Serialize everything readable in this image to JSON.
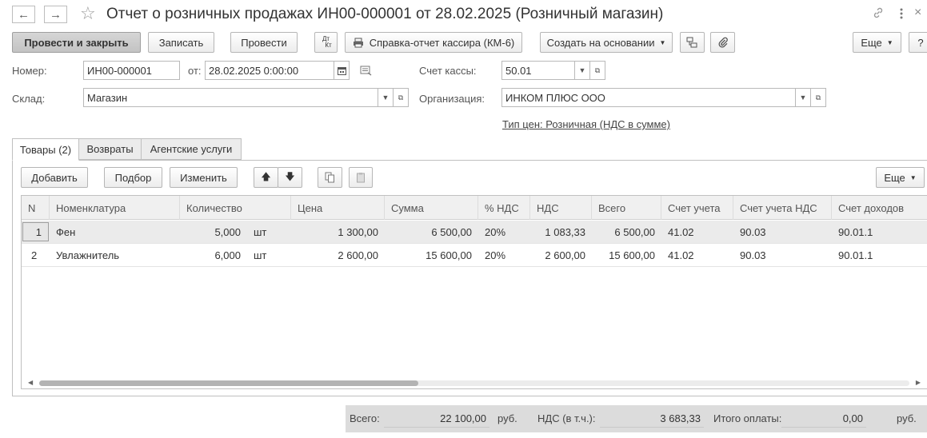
{
  "title": "Отчет о розничных продажах ИН00-000001 от 28.02.2025 (Розничный магазин)",
  "nav": {
    "back_icon": "←",
    "forward_icon": "→"
  },
  "toolbar": {
    "post_close": "Провести и закрыть",
    "save": "Записать",
    "post": "Провести",
    "dt_kt_top": "Дт",
    "dt_kt_bottom": "Кт",
    "cashier_report": "Справка-отчет кассира (КМ-6)",
    "create_based": "Создать на основании",
    "more": "Еще",
    "help": "?"
  },
  "form": {
    "number_label": "Номер:",
    "number_value": "ИН00-000001",
    "date_label": "от:",
    "date_value": "28.02.2025  0:00:00",
    "cash_account_label": "Счет кассы:",
    "cash_account_value": "50.01",
    "warehouse_label": "Склад:",
    "warehouse_value": "Магазин",
    "org_label": "Организация:",
    "org_value": "ИНКОМ ПЛЮС ООО",
    "price_type_link": "Тип цен: Розничная (НДС в сумме)"
  },
  "tabs": [
    {
      "label": "Товары (2)"
    },
    {
      "label": "Возвраты"
    },
    {
      "label": "Агентские услуги"
    }
  ],
  "table_toolbar": {
    "add": "Добавить",
    "pick": "Подбор",
    "change": "Изменить",
    "more": "Еще"
  },
  "table": {
    "columns": [
      "N",
      "Номенклатура",
      "Количество",
      "Цена",
      "Сумма",
      "% НДС",
      "НДС",
      "Всего",
      "Счет учета",
      "Счет учета НДС",
      "Счет доходов"
    ],
    "rows": [
      {
        "n": "1",
        "name": "Фен",
        "qty": "5,000",
        "unit": "шт",
        "price": "1 300,00",
        "sum": "6 500,00",
        "vat_rate": "20%",
        "vat": "1 083,33",
        "total": "6 500,00",
        "account": "41.02",
        "vat_account": "90.03",
        "income_account": "90.01.1"
      },
      {
        "n": "2",
        "name": "Увлажнитель",
        "qty": "6,000",
        "unit": "шт",
        "price": "2 600,00",
        "sum": "15 600,00",
        "vat_rate": "20%",
        "vat": "2 600,00",
        "total": "15 600,00",
        "account": "41.02",
        "vat_account": "90.03",
        "income_account": "90.01.1"
      }
    ]
  },
  "totals": {
    "total_label": "Всего:",
    "total_value": "22 100,00",
    "currency1": "руб.",
    "vat_label": "НДС (в т.ч.):",
    "vat_value": "3 683,33",
    "paid_label": "Итого оплаты:",
    "paid_value": "0,00",
    "currency2": "руб."
  }
}
